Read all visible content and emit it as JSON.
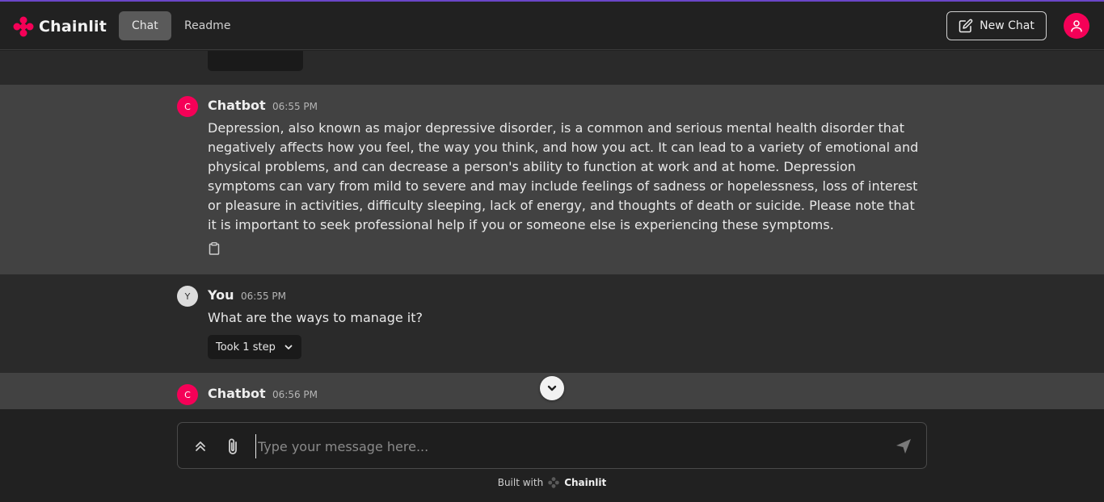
{
  "app": {
    "name": "Chainlit",
    "brand_color": "#f50057"
  },
  "nav": {
    "tabs": [
      {
        "label": "Chat",
        "active": true
      },
      {
        "label": "Readme",
        "active": false
      }
    ]
  },
  "header": {
    "new_chat_label": "New Chat"
  },
  "messages": [
    {
      "author": "Chatbot",
      "avatar_letter": "C",
      "time": "06:55 PM",
      "text": "Depression, also known as major depressive disorder, is a common and serious mental health disorder that negatively affects how you feel, the way you think, and how you act. It can lead to a variety of emotional and physical problems, and can decrease a person's ability to function at work and at home. Depression symptoms can vary from mild to severe and may include feelings of sadness or hopelessness, loss of interest or pleasure in activities, difficulty sleeping, lack of energy, and thoughts of death or suicide. Please note that it is important to seek professional help if you or someone else is experiencing these symptoms."
    },
    {
      "author": "You",
      "avatar_letter": "Y",
      "time": "06:55 PM",
      "text": "What are the ways to manage it?",
      "step_label": "Took 1 step"
    },
    {
      "author": "Chatbot",
      "avatar_letter": "C",
      "time": "06:56 PM",
      "text": ""
    }
  ],
  "composer": {
    "placeholder": "Type your message here..."
  },
  "footer": {
    "built_with": "Built with",
    "brand": "Chainlit"
  },
  "icons": [
    "chainlit-logo-icon",
    "edit-icon",
    "user-icon",
    "copy-icon",
    "chevron-down-icon",
    "chevrons-up-icon",
    "paperclip-icon",
    "send-icon"
  ]
}
